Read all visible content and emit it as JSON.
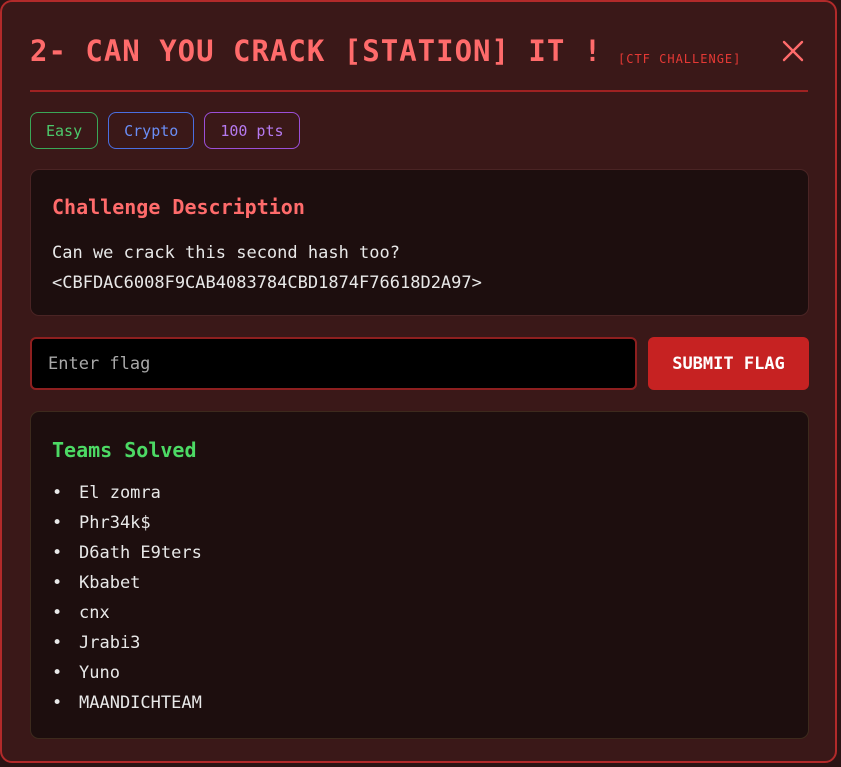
{
  "header": {
    "title": "2- CAN YOU CRACK [STATION] IT !",
    "subtitle": "[CTF CHALLENGE]",
    "close_icon": "close-icon"
  },
  "tags": {
    "difficulty": "Easy",
    "category": "Crypto",
    "points": "100 pts"
  },
  "description": {
    "title": "Challenge Description",
    "line1": "Can we crack this second hash too?",
    "line2": "<CBFDAC6008F9CAB4083784CBD1874F76618D2A97>"
  },
  "flag_form": {
    "placeholder": "Enter flag",
    "value": "",
    "submit_label": "SUBMIT FLAG"
  },
  "solved": {
    "title": "Teams Solved",
    "bullet": "•",
    "teams": [
      "El zomra",
      "Phr34k$",
      "D6ath E9ters",
      "Kbabet",
      "cnx",
      "Jrabi3",
      "Yuno",
      "MAANDICHTEAM"
    ]
  },
  "colors": {
    "accent": "#ff6b6b",
    "submit": "#c62222",
    "easy": "#4cc96b",
    "crypto": "#6a8df5",
    "points": "#b57af0",
    "solved": "#4cd964"
  }
}
